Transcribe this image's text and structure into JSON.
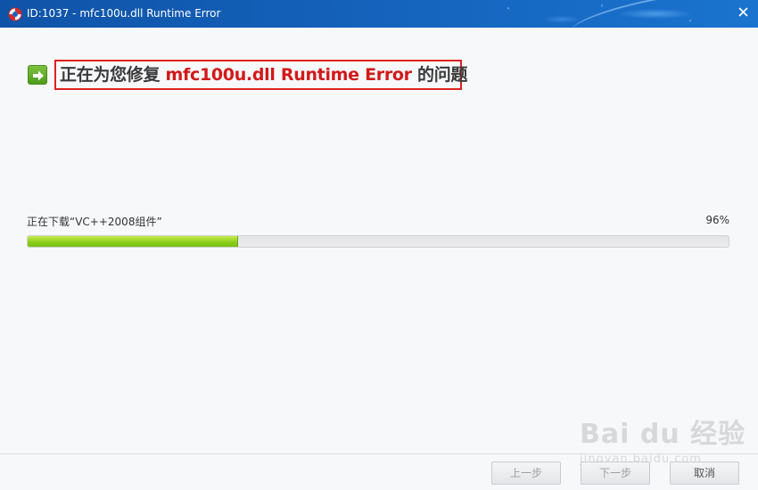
{
  "window": {
    "title": "ID:1037 - mfc100u.dll Runtime Error",
    "icon": "lifebuoy-icon",
    "close_icon": "close-icon"
  },
  "heading": {
    "icon": "green-arrow-right-icon",
    "prefix": "正在为您修复 ",
    "error_name": "mfc100u.dll Runtime Error",
    "suffix": " 的问题",
    "highlight_color": "#e02020",
    "error_color": "#d21919"
  },
  "download": {
    "label": "正在下载“VC++2008组件”",
    "percent_text": "96%",
    "bar_fill_fraction": 0.3,
    "bar_color": "#8fce1e"
  },
  "buttons": {
    "prev": "上一步",
    "next": "下一步",
    "cancel": "取消"
  },
  "watermark": {
    "brand": "Bai du 经验",
    "url": "jingyan.baidu.com"
  }
}
